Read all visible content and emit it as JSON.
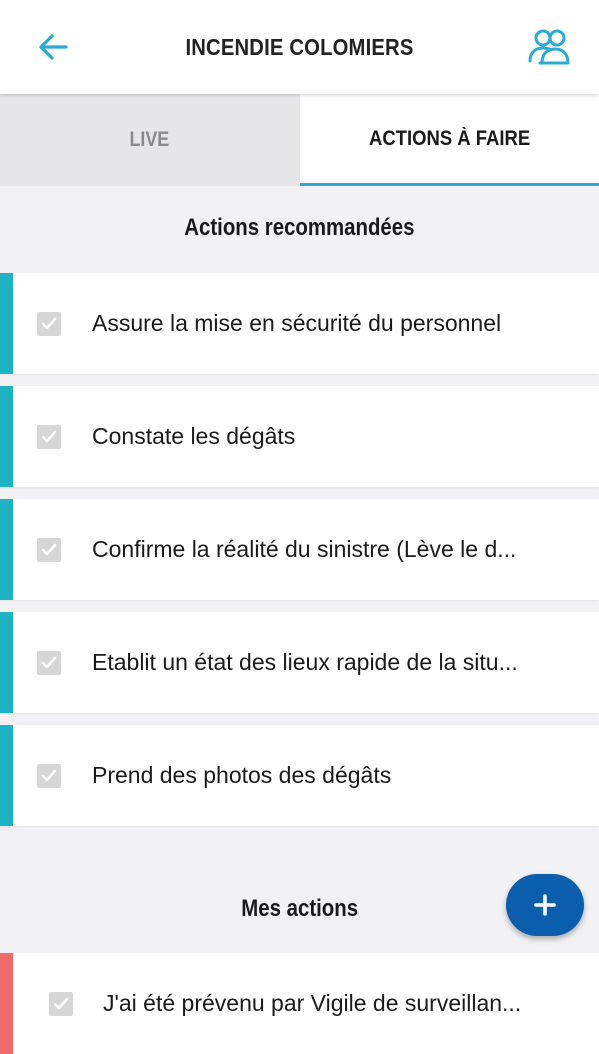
{
  "header": {
    "title": "INCENDIE COLOMIERS",
    "back_icon": "arrow-left-icon",
    "users_icon": "users-icon"
  },
  "tabs": [
    {
      "label": "LIVE",
      "active": false
    },
    {
      "label": "ACTIONS À FAIRE",
      "active": true
    }
  ],
  "recommended": {
    "title": "Actions recommandées",
    "items": [
      {
        "label": "Assure la mise en sécurité du personnel"
      },
      {
        "label": "Constate les dégâts"
      },
      {
        "label": "Confirme la réalité du sinistre (Lève le d..."
      },
      {
        "label": "Etablit un état des lieux rapide de la situ..."
      },
      {
        "label": "Prend des photos des dégâts"
      }
    ]
  },
  "mine": {
    "title": "Mes actions",
    "items": [
      {
        "label": "J'ai été prévenu par Vigile de surveillan..."
      }
    ]
  },
  "fab": {
    "icon": "plus-icon"
  },
  "colors": {
    "accent": "#29abd4",
    "recommended_bar": "#1eb3c2",
    "mine_bar": "#ef6a6a",
    "fab": "#0b5eab"
  }
}
